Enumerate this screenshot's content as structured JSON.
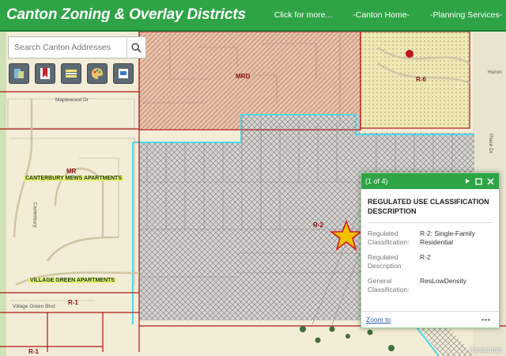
{
  "header": {
    "title": "Canton Zoning & Overlay Districts",
    "nav": [
      "Click for more...",
      "-Canton Home-",
      "-Planning Services-"
    ]
  },
  "search": {
    "placeholder": "Search Canton Addresses"
  },
  "toolbar": {
    "tools": [
      {
        "icon": "layers-icon"
      },
      {
        "icon": "bookmark-icon"
      },
      {
        "icon": "basemap-icon"
      },
      {
        "icon": "palette-icon"
      },
      {
        "icon": "print-icon"
      }
    ]
  },
  "map": {
    "zones": [
      "MRD",
      "R-6",
      "MR",
      "R-2",
      "R-1",
      "R-1"
    ],
    "places": [
      "CANTERBURY MEWS APARTMENTS",
      "VILLAGE GREEN APARTMENTS"
    ],
    "streets": [
      "Maplewood Dr",
      "Canterbury",
      "Huron",
      "Place Dr",
      "Village Green Blvd"
    ]
  },
  "popup": {
    "counter": "(1 of 4)",
    "title": "REGULATED USE CLASSIFICATION DESCRIPTION",
    "attributes": [
      {
        "label": "Regulated Classification:",
        "value": "R-2: Single-Family Residential"
      },
      {
        "label": "Regulated Description:",
        "value": "R-2"
      },
      {
        "label": "General Classification:",
        "value": "ResLowDensity"
      }
    ],
    "zoom_label": "Zoom to",
    "more_label": "•••"
  },
  "watermark": "Realcomp",
  "colors": {
    "header_green": "#2fa447",
    "zone_outline": "#b01818",
    "overlay_cyan": "#4fd8e8",
    "marker_star": "#f2c200"
  }
}
